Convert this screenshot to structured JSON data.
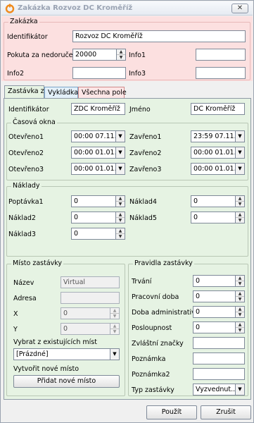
{
  "window": {
    "title": "Zakázka Rozvoz DC Kroměříž",
    "close_label": "✕"
  },
  "order": {
    "legend": "Zakázka",
    "identifier_label": "Identifikátor",
    "identifier_value": "Rozvoz DC Kroměříž",
    "penalty_label": "Pokuta za nedoručení",
    "penalty_value": "20000",
    "info1_label": "Info1",
    "info1_value": "",
    "info2_label": "Info2",
    "info2_value": "",
    "info3_label": "Info3",
    "info3_value": ""
  },
  "tabs": [
    "Zastávka z",
    "Vykládka",
    "Všechna pole"
  ],
  "stop": {
    "identifier_label": "Identifikátor",
    "identifier_value": "ZDC Kroměříž",
    "name_label": "Jméno",
    "name_value": "DC Kroměříž"
  },
  "windows": {
    "legend": "Časová okna",
    "open1_label": "Otevřeno1",
    "open1_value": "00:00 07.11.2",
    "close1_label": "Zavřeno1",
    "close1_value": "23:59 07.11.2",
    "open2_label": "Otevřeno2",
    "open2_value": "00:00 01.01.0",
    "close2_label": "Zavřeno2",
    "close2_value": "00:00 01.01.0",
    "open3_label": "Otevřeno3",
    "open3_value": "00:00 01.01.0",
    "close3_label": "Zavřeno3",
    "close3_value": "00:00 01.01.0"
  },
  "costs": {
    "legend": "Náklady",
    "demand1_label": "Poptávka1",
    "demand1_value": "0",
    "cost4_label": "Náklad4",
    "cost4_value": "0",
    "cost2_label": "Náklad2",
    "cost2_value": "0",
    "cost5_label": "Náklad5",
    "cost5_value": "0",
    "cost3_label": "Náklad3",
    "cost3_value": "0"
  },
  "place": {
    "legend": "Místo zastávky",
    "name_label": "Název",
    "name_value": "Virtual",
    "address_label": "Adresa",
    "address_value": "",
    "x_label": "X",
    "x_value": "0",
    "y_label": "Y",
    "y_value": "0",
    "choose_label": "Vybrat z existujících míst",
    "choose_value": "[Prázdné]",
    "create_label": "Vytvořit nové místo",
    "add_button": "Přidat nové místo"
  },
  "rules": {
    "legend": "Pravidla zastávky",
    "duration_label": "Trvání",
    "duration_value": "0",
    "worktime_label": "Pracovní doba",
    "worktime_value": "0",
    "admin_label": "Doba administrativy",
    "admin_value": "0",
    "sequence_label": "Posloupnost",
    "sequence_value": "0",
    "special_label": "Zvláštní značky",
    "special_value": "",
    "note_label": "Poznámka",
    "note_value": "",
    "note2_label": "Poznámka2",
    "note2_value": "",
    "type_label": "Typ zastávky",
    "type_value": "Vyzvednut..."
  },
  "footer": {
    "apply": "Použít",
    "cancel": "Zrušit"
  },
  "colors": {
    "order_bg": "#fce0e0",
    "tab_bg": "#e6f3e3"
  }
}
